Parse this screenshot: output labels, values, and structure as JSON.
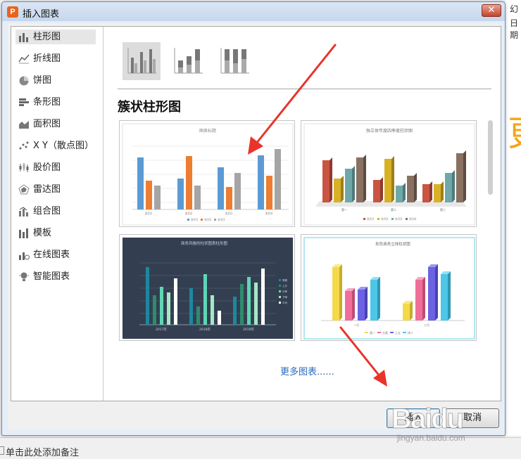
{
  "dialog": {
    "title": "插入图表",
    "app_icon": "P",
    "close_glyph": "✕"
  },
  "sidebar": {
    "items": [
      {
        "label": "柱形图",
        "icon": "column-chart-icon",
        "active": true
      },
      {
        "label": "折线图",
        "icon": "line-chart-icon"
      },
      {
        "label": "饼图",
        "icon": "pie-chart-icon"
      },
      {
        "label": "条形图",
        "icon": "bar-chart-icon"
      },
      {
        "label": "面积图",
        "icon": "area-chart-icon"
      },
      {
        "label": "X Y（散点图）",
        "icon": "scatter-chart-icon"
      },
      {
        "label": "股价图",
        "icon": "stock-chart-icon"
      },
      {
        "label": "雷达图",
        "icon": "radar-chart-icon"
      },
      {
        "label": "组合图",
        "icon": "combo-chart-icon"
      },
      {
        "label": "模板",
        "icon": "template-icon"
      },
      {
        "label": "在线图表",
        "icon": "online-chart-icon"
      },
      {
        "label": "智能图表",
        "icon": "smart-chart-icon"
      }
    ]
  },
  "main": {
    "subtypes": [
      "clustered-column",
      "stacked-column",
      "percent-stacked-column"
    ],
    "section_title": "簇状柱形图",
    "more_link": "更多图表......",
    "thumbs": [
      {
        "title": "图表标题",
        "legend": [
          "系列1",
          "系列2",
          "系列3"
        ],
        "categories": [
          "类别1",
          "类别2",
          "类别3",
          "类别4"
        ],
        "colors": [
          "#5b9bd5",
          "#ed7d31",
          "#a5a5a5"
        ]
      },
      {
        "title": "独立体年度四季度柱状图",
        "legend": [
          "系列1",
          "系列2",
          "系列3",
          "系列4"
        ],
        "categories": [
          "第一",
          "第二",
          "第三"
        ],
        "colors": [
          "#c95442",
          "#d8b126",
          "#6fa8a8",
          "#8a7060"
        ]
      },
      {
        "title": "商务风格的柱状图表柱形图",
        "legend": [
          "周期",
          "上升",
          "中等",
          "下降",
          "平均"
        ],
        "categories": [
          "2017年",
          "2018年",
          "2019年"
        ],
        "colors": [
          "#1e87a0",
          "#2d8c6c",
          "#5fd6b5",
          "#a4e8c6",
          "#ffffff"
        ]
      },
      {
        "title": "彩色商务立体柱状图",
        "legend": [
          "类一",
          "分类",
          "上五",
          "排八"
        ],
        "categories": [
          "一月",
          "二月"
        ],
        "colors": [
          "#f5d94a",
          "#f06e9a",
          "#6b63e3",
          "#4cc7e8"
        ]
      }
    ]
  },
  "buttons": {
    "insert": "插入",
    "cancel": "取消"
  },
  "background": {
    "note": "单击此处添加备注",
    "right_texts": [
      "幻",
      "日期"
    ],
    "right_big": "更"
  },
  "watermark": {
    "logo": "Baidu",
    "url": "jingyan.baidu.com"
  }
}
